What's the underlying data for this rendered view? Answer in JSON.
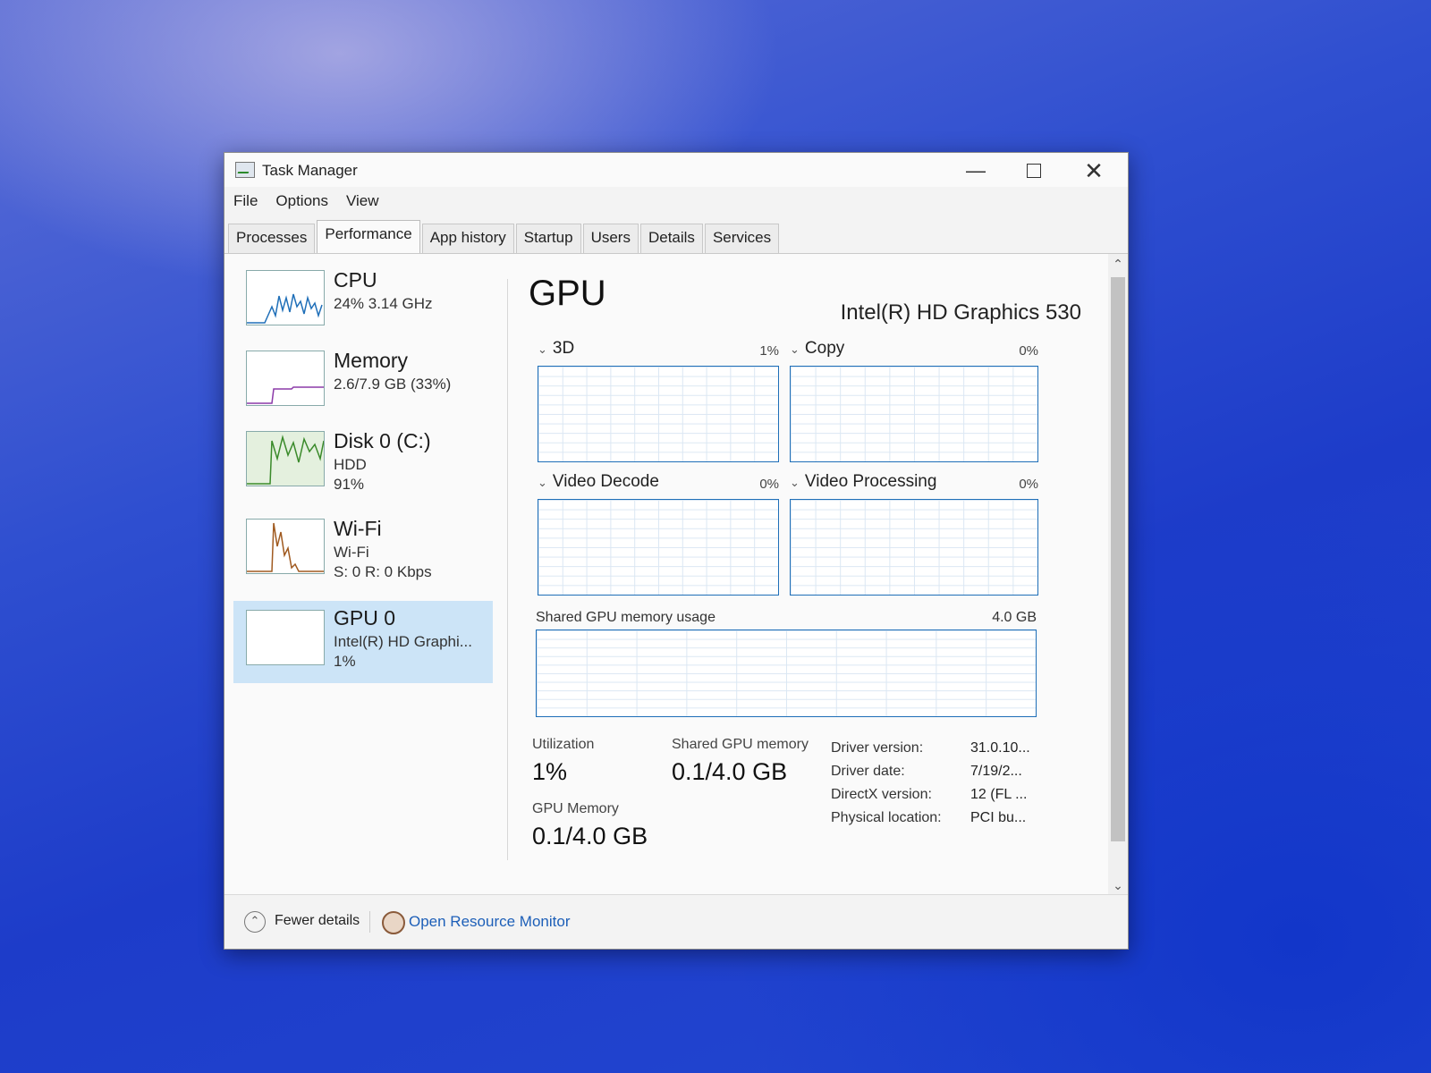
{
  "window": {
    "title": "Task Manager"
  },
  "menu": [
    "File",
    "Options",
    "View"
  ],
  "tabs": [
    "Processes",
    "Performance",
    "App history",
    "Startup",
    "Users",
    "Details",
    "Services"
  ],
  "active_tab": "Performance",
  "sidebar": {
    "items": [
      {
        "name": "CPU",
        "sub1": "24% 3.14 GHz",
        "sub2": ""
      },
      {
        "name": "Memory",
        "sub1": "2.6/7.9 GB (33%)",
        "sub2": ""
      },
      {
        "name": "Disk 0 (C:)",
        "sub1": "HDD",
        "sub2": "91%"
      },
      {
        "name": "Wi-Fi",
        "sub1": "Wi-Fi",
        "sub2": "S: 0 R: 0 Kbps"
      },
      {
        "name": "GPU 0",
        "sub1": "Intel(R) HD Graphi...",
        "sub2": "1%"
      }
    ],
    "selected": "GPU 0"
  },
  "gpu": {
    "title": "GPU",
    "model": "Intel(R) HD Graphics 530",
    "engines": [
      {
        "name": "3D",
        "pct": "1%"
      },
      {
        "name": "Copy",
        "pct": "0%"
      },
      {
        "name": "Video Decode",
        "pct": "0%"
      },
      {
        "name": "Video Processing",
        "pct": "0%"
      }
    ],
    "shared_label": "Shared GPU memory usage",
    "shared_max": "4.0 GB",
    "stats": {
      "utilization_label": "Utilization",
      "utilization_value": "1%",
      "shared_mem_label": "Shared GPU memory",
      "shared_mem_value": "0.1/4.0 GB",
      "gpu_mem_label": "GPU Memory",
      "gpu_mem_value": "0.1/4.0 GB"
    },
    "properties": [
      {
        "key": "Driver version:",
        "value": "31.0.10..."
      },
      {
        "key": "Driver date:",
        "value": "7/19/2..."
      },
      {
        "key": "DirectX version:",
        "value": "12 (FL ..."
      },
      {
        "key": "Physical location:",
        "value": "PCI bu..."
      }
    ]
  },
  "footer": {
    "fewer_details": "Fewer details",
    "open_resource_monitor": "Open Resource Monitor"
  },
  "colors": {
    "selected_bg": "#cce4f7",
    "graph_border": "#1f6fb8",
    "link": "#1d5fb8",
    "cpu_line": "#1f6fb8",
    "memory_line": "#8b3aa8",
    "disk_line": "#3a8a2a",
    "wifi_line": "#a05a20"
  }
}
